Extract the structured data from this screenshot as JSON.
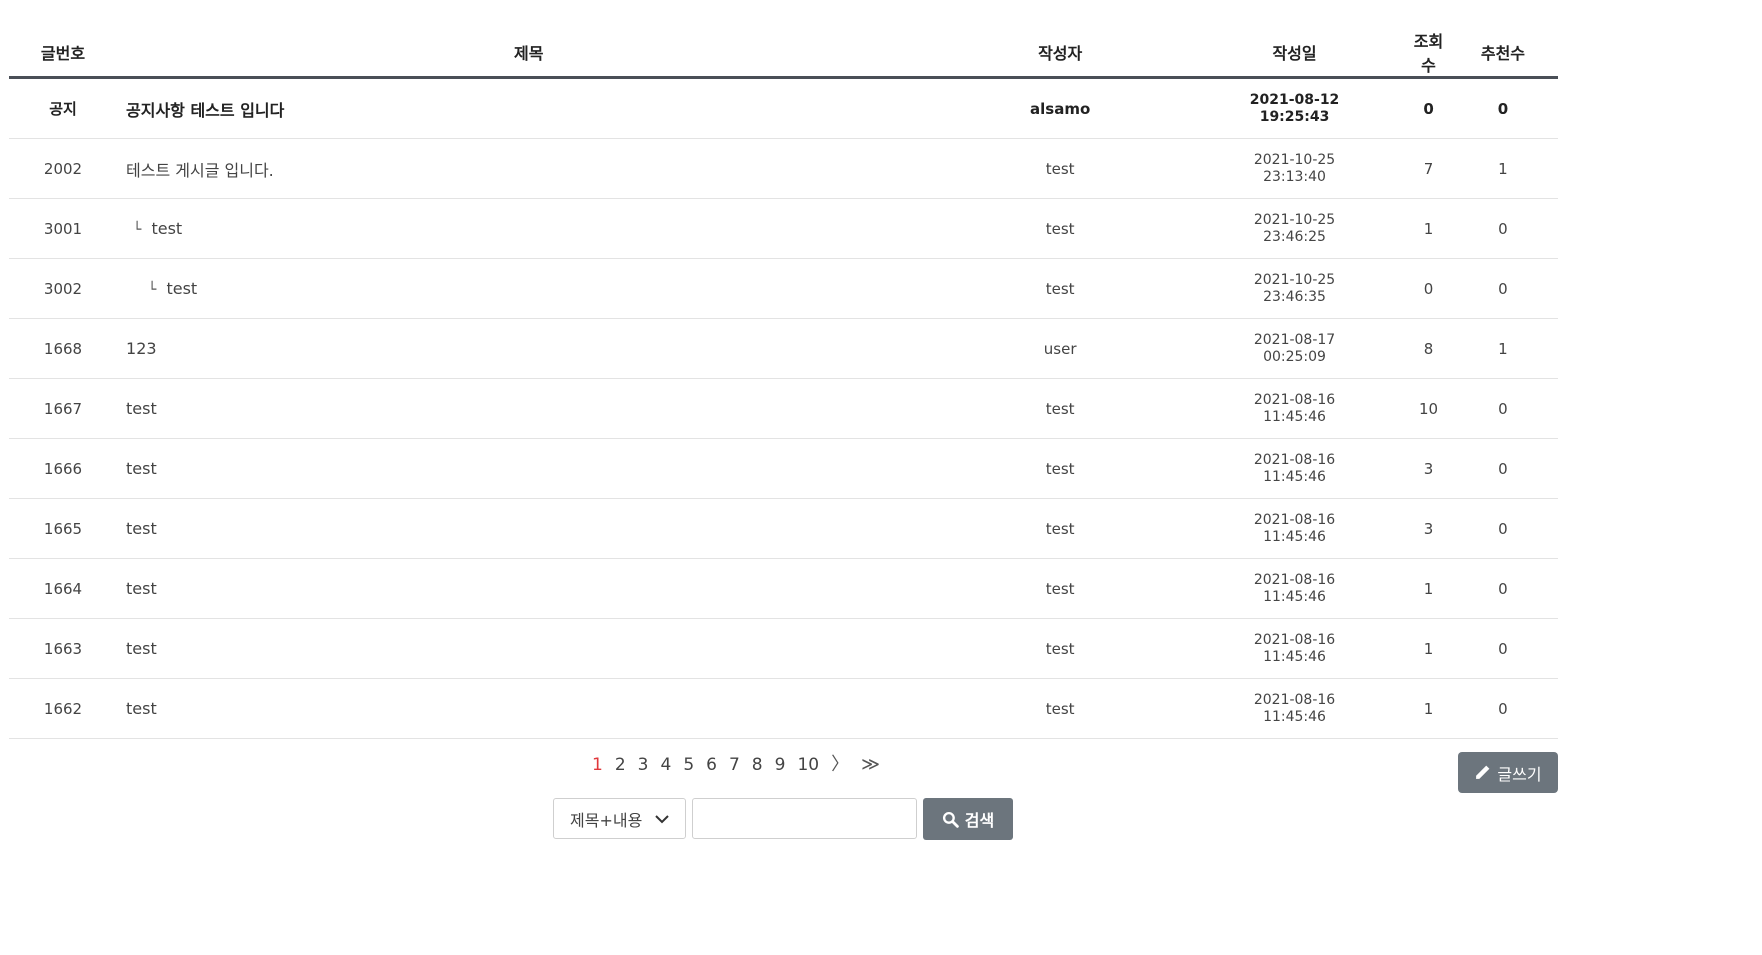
{
  "table": {
    "headers": {
      "no": "글번호",
      "title": "제목",
      "writer": "작성자",
      "date": "작성일",
      "views": "조회수",
      "recommend": "추천수"
    },
    "rows": [
      {
        "no": "공지",
        "title": "공지사항 테스트 입니다",
        "writer": "alsamo",
        "date": "2021-08-12",
        "time": "19:25:43",
        "views": "0",
        "recommend": "0",
        "reply_mark": ""
      },
      {
        "no": "2002",
        "title": "테스트 게시글 입니다.",
        "writer": "test",
        "date": "2021-10-25",
        "time": "23:13:40",
        "views": "7",
        "recommend": "1",
        "reply_mark": ""
      },
      {
        "no": "3001",
        "title": "test",
        "writer": "test",
        "date": "2021-10-25",
        "time": "23:46:25",
        "views": "1",
        "recommend": "0",
        "reply_mark": "└"
      },
      {
        "no": "3002",
        "title": "test",
        "writer": "test",
        "date": "2021-10-25",
        "time": "23:46:35",
        "views": "0",
        "recommend": "0",
        "reply_mark": "└"
      },
      {
        "no": "1668",
        "title": "123",
        "writer": "user",
        "date": "2021-08-17",
        "time": "00:25:09",
        "views": "8",
        "recommend": "1",
        "reply_mark": ""
      },
      {
        "no": "1667",
        "title": "test",
        "writer": "test",
        "date": "2021-08-16",
        "time": "11:45:46",
        "views": "10",
        "recommend": "0",
        "reply_mark": ""
      },
      {
        "no": "1666",
        "title": "test",
        "writer": "test",
        "date": "2021-08-16",
        "time": "11:45:46",
        "views": "3",
        "recommend": "0",
        "reply_mark": ""
      },
      {
        "no": "1665",
        "title": "test",
        "writer": "test",
        "date": "2021-08-16",
        "time": "11:45:46",
        "views": "3",
        "recommend": "0",
        "reply_mark": ""
      },
      {
        "no": "1664",
        "title": "test",
        "writer": "test",
        "date": "2021-08-16",
        "time": "11:45:46",
        "views": "1",
        "recommend": "0",
        "reply_mark": ""
      },
      {
        "no": "1663",
        "title": "test",
        "writer": "test",
        "date": "2021-08-16",
        "time": "11:45:46",
        "views": "1",
        "recommend": "0",
        "reply_mark": ""
      },
      {
        "no": "1662",
        "title": "test",
        "writer": "test",
        "date": "2021-08-16",
        "time": "11:45:46",
        "views": "1",
        "recommend": "0",
        "reply_mark": ""
      }
    ]
  },
  "pagination": {
    "pages": [
      "1",
      "2",
      "3",
      "4",
      "5",
      "6",
      "7",
      "8",
      "9",
      "10"
    ],
    "current": "1",
    "next": "〉",
    "last": "≫"
  },
  "write_button": {
    "label": "글쓰기",
    "icon": "pencil-icon"
  },
  "search": {
    "select_value": "제목+내용",
    "input_value": "",
    "button_label": "검색",
    "button_icon": "search-icon"
  },
  "colors": {
    "button": "#6c757d",
    "current_page": "#e0383c",
    "header_border": "#4a4f57"
  }
}
